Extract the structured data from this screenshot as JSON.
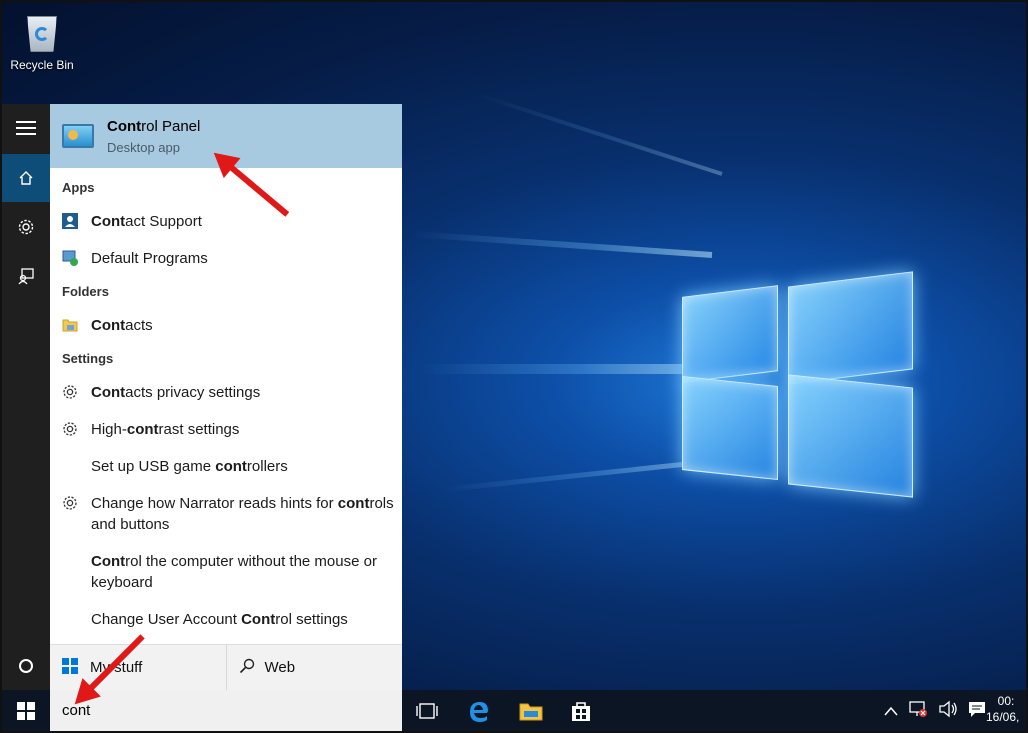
{
  "desktop": {
    "recycle_bin_label": "Recycle Bin"
  },
  "best_match": {
    "title_bold": "Cont",
    "title_rest": "rol Panel",
    "subtitle": "Desktop app"
  },
  "sections": {
    "apps": "Apps",
    "folders": "Folders",
    "settings": "Settings"
  },
  "apps": [
    {
      "bold": "Cont",
      "rest": "act Support"
    },
    {
      "bold": "",
      "rest": "Default Programs"
    }
  ],
  "folders": [
    {
      "bold": "Cont",
      "rest": "acts"
    }
  ],
  "settings": {
    "s1_bold": "Cont",
    "s1_rest": "acts privacy settings",
    "s2_pre": "High-",
    "s2_bold": "cont",
    "s2_rest": "rast settings",
    "s3_pre": "Set up USB game ",
    "s3_bold": "cont",
    "s3_rest": "rollers",
    "s4_pre": "Change how Narrator reads hints for ",
    "s4_bold": "cont",
    "s4_rest": "rols and buttons",
    "s5_bold": "Cont",
    "s5_rest": "rol the computer without the mouse or keyboard",
    "s6_pre": "Change User Account ",
    "s6_bold": "Cont",
    "s6_rest": "rol settings"
  },
  "filter": {
    "my_stuff": "My stuff",
    "web": "Web"
  },
  "taskbar": {
    "search_value": "cont",
    "clock_time": "00:",
    "clock_date": "16/06,"
  },
  "colors": {
    "accent": "#0e4d77",
    "best_match_bg": "#a8cae0",
    "annotation_arrow": "#e01818"
  }
}
